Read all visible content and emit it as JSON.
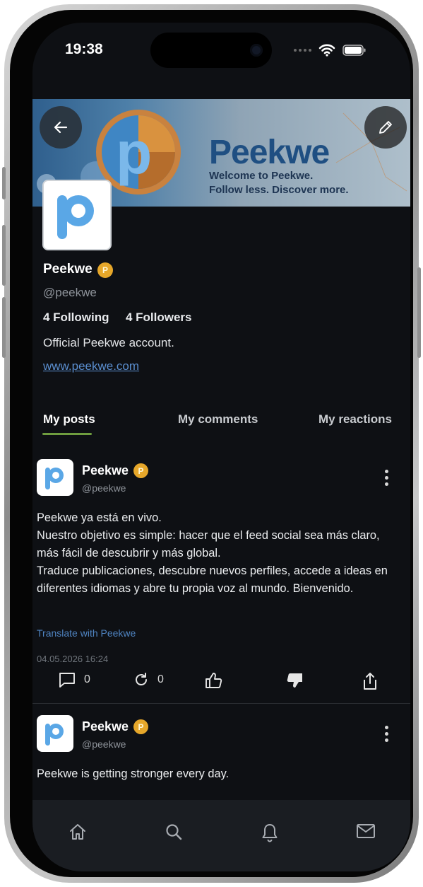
{
  "status": {
    "time": "19:38"
  },
  "banner": {
    "brand": "Peekwe",
    "tagline_1": "Welcome to Peekwe.",
    "tagline_2": "Follow less. Discover more."
  },
  "profile": {
    "name": "Peekwe",
    "handle": "@peekwe",
    "following": "4 Following",
    "followers": "4 Followers",
    "bio": "Official Peekwe account.",
    "website": "www.peekwe.com"
  },
  "tabs": [
    {
      "label": "My posts",
      "active": true
    },
    {
      "label": "My comments",
      "active": false
    },
    {
      "label": "My reactions",
      "active": false
    }
  ],
  "posts": [
    {
      "author": "Peekwe",
      "handle": "@peekwe",
      "text": "Peekwe ya está en vivo.\nNuestro objetivo es simple: hacer que el feed social sea más claro, más fácil de descubrir y más global.\nTraduce publicaciones, descubre nuevos perfiles, accede a ideas en diferentes idiomas y abre tu propia voz al mundo. Bienvenido.",
      "translate_label": "Translate with Peekwe",
      "timestamp": "04.05.2026 16:24",
      "comments": "0",
      "reposts": "0"
    },
    {
      "author": "Peekwe",
      "handle": "@peekwe",
      "text": "Peekwe is getting stronger every day."
    }
  ],
  "nav": [
    "home-icon",
    "search-icon",
    "bell-icon",
    "mail-icon"
  ],
  "colors": {
    "accent_tab": "#6f9d3f",
    "link": "#5b8fd0",
    "badge": "#e6a72a",
    "background": "#0e1014"
  }
}
